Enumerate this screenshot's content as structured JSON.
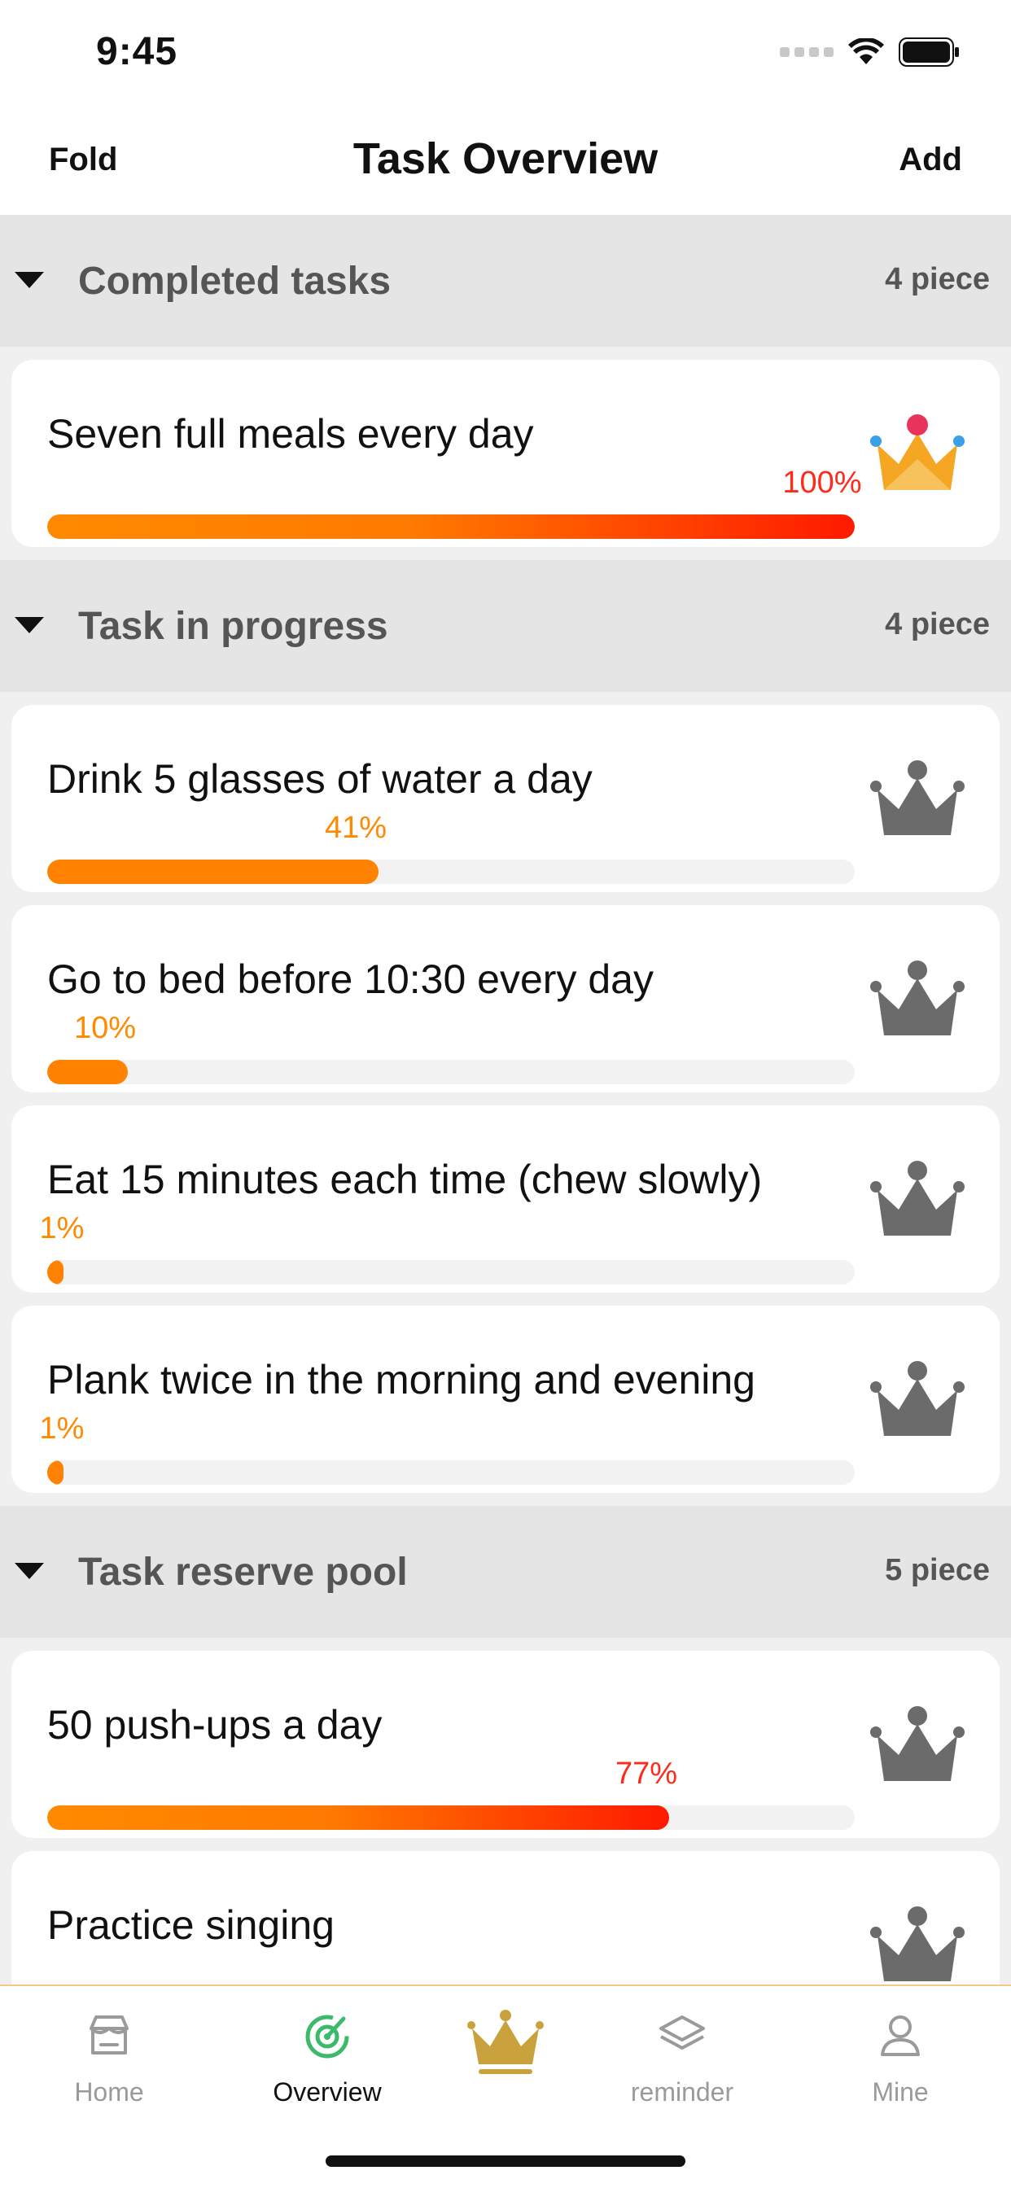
{
  "status_bar": {
    "time": "9:45"
  },
  "nav": {
    "left": "Fold",
    "title": "Task Overview",
    "right": "Add"
  },
  "sections": [
    {
      "title": "Completed tasks",
      "count": "4 piece",
      "tasks": [
        {
          "title": "Seven full meals every day",
          "percent_label": "100%",
          "progress": 1.0,
          "crown": "golden-crown-icon"
        }
      ]
    },
    {
      "title": "Task in progress",
      "count": "4 piece",
      "tasks": [
        {
          "title": "Drink 5 glasses of water a day",
          "percent_label": "41%",
          "progress": 0.41,
          "crown": "gray-crown-icon"
        },
        {
          "title": "Go to bed before 10:30 every day",
          "percent_label": "10%",
          "progress": 0.1,
          "crown": "gray-crown-icon"
        },
        {
          "title": "Eat 15 minutes each time (chew slowly)",
          "percent_label": "1%",
          "progress": 0.01,
          "crown": "gray-crown-icon"
        },
        {
          "title": "Plank twice in the morning and evening",
          "percent_label": "1%",
          "progress": 0.01,
          "crown": "gray-crown-icon"
        }
      ]
    },
    {
      "title": "Task reserve pool",
      "count": "5 piece",
      "tasks": [
        {
          "title": "50 push-ups a day",
          "percent_label": "77%",
          "progress": 0.77,
          "crown": "gray-crown-icon"
        },
        {
          "title": "Practice singing",
          "percent_label": "",
          "progress": 0,
          "crown": "gray-crown-icon"
        }
      ]
    }
  ],
  "tabs": [
    {
      "label": "Home",
      "icon": "store-icon",
      "active": false
    },
    {
      "label": "Overview",
      "icon": "target-icon",
      "active": true
    },
    {
      "label": "",
      "icon": "crown-icon",
      "active": false
    },
    {
      "label": "reminder",
      "icon": "layers-icon",
      "active": false
    },
    {
      "label": "Mine",
      "icon": "person-icon",
      "active": false
    }
  ],
  "colors": {
    "accent_orange": "#ff8200",
    "accent_red": "#ff1a00",
    "active_tab_green": "#3cba6c",
    "gold": "#c9a23e",
    "crown_gray": "#6b6b6b",
    "section_bg": "#e5e5e5"
  }
}
